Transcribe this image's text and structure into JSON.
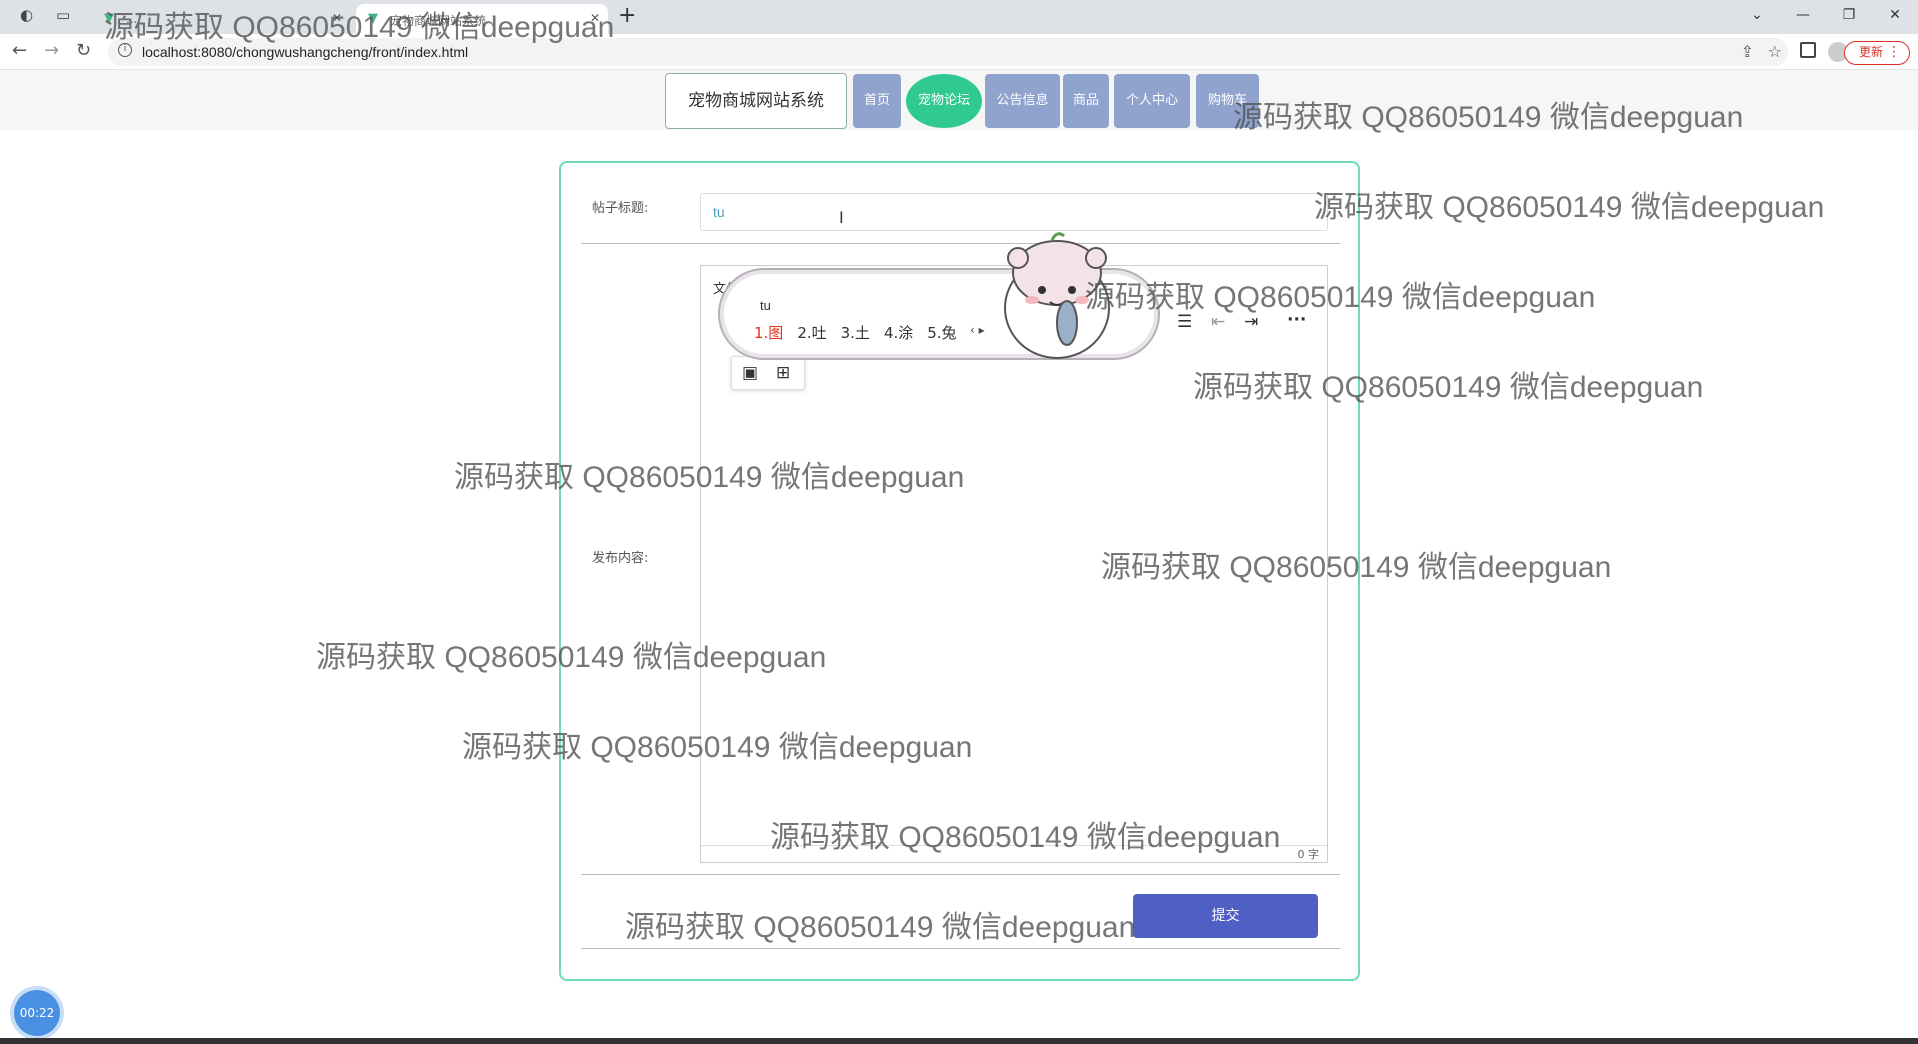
{
  "browser": {
    "tabs": [
      {
        "label": "..."
      },
      {
        "label": "宠物商城网站系统"
      }
    ],
    "url": "localhost:8080/chongwushangcheng/front/index.html",
    "update_label": "更新"
  },
  "nav": {
    "brand": "宠物商城网站系统",
    "items": [
      {
        "label": "首页"
      },
      {
        "label": "宠物论坛"
      },
      {
        "label": "公告信息"
      },
      {
        "label": "商品"
      },
      {
        "label": "个人中心"
      },
      {
        "label": "购物车"
      }
    ]
  },
  "form": {
    "title_label": "帖子标题:",
    "title_value": "tu",
    "content_label": "发布内容:",
    "editor_toolbar_text": "文件",
    "char_count": "0 字",
    "submit_label": "提交"
  },
  "ime": {
    "typed": "tu",
    "candidates": [
      "1.图",
      "2.吐",
      "3.土",
      "4.涂",
      "5.兔"
    ]
  },
  "timer": "00:22",
  "watermark": "源码获取 QQ86050149 微信deepguan"
}
